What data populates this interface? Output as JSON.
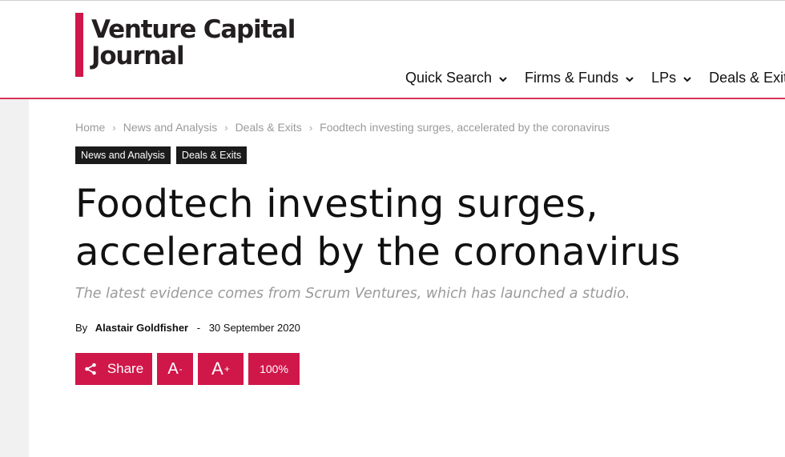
{
  "logo": {
    "line1": "Venture Capital",
    "line2": "Journal",
    "accent": "#d0174a"
  },
  "nav": [
    {
      "label": "Quick Search",
      "icon": "chevron-down-icon"
    },
    {
      "label": "Firms & Funds",
      "icon": "chevron-down-icon"
    },
    {
      "label": "LPs",
      "icon": "chevron-down-icon"
    },
    {
      "label": "Deals & Exits",
      "icon": "chevron-down-icon"
    }
  ],
  "breadcrumb": {
    "items": [
      "Home",
      "News and Analysis",
      "Deals & Exits",
      "Foodtech investing surges, accelerated by the coronavirus"
    ],
    "separator": "›"
  },
  "tags": [
    "News and Analysis",
    "Deals & Exits"
  ],
  "article": {
    "title_line1": "Foodtech investing surges,",
    "title_line2": "accelerated by the coronavirus",
    "subtitle": "The latest evidence comes from Scrum Ventures, which has launched a studio.",
    "by_label": "By",
    "author": "Alastair Goldfisher",
    "date_separator": "-",
    "date": "30 September 2020"
  },
  "actions": {
    "share_label": "Share",
    "share_icon": "share-icon",
    "decrease_label": "A",
    "decrease_sup": "-",
    "increase_label": "A",
    "increase_sup": "+",
    "zoom_label": "100%"
  }
}
